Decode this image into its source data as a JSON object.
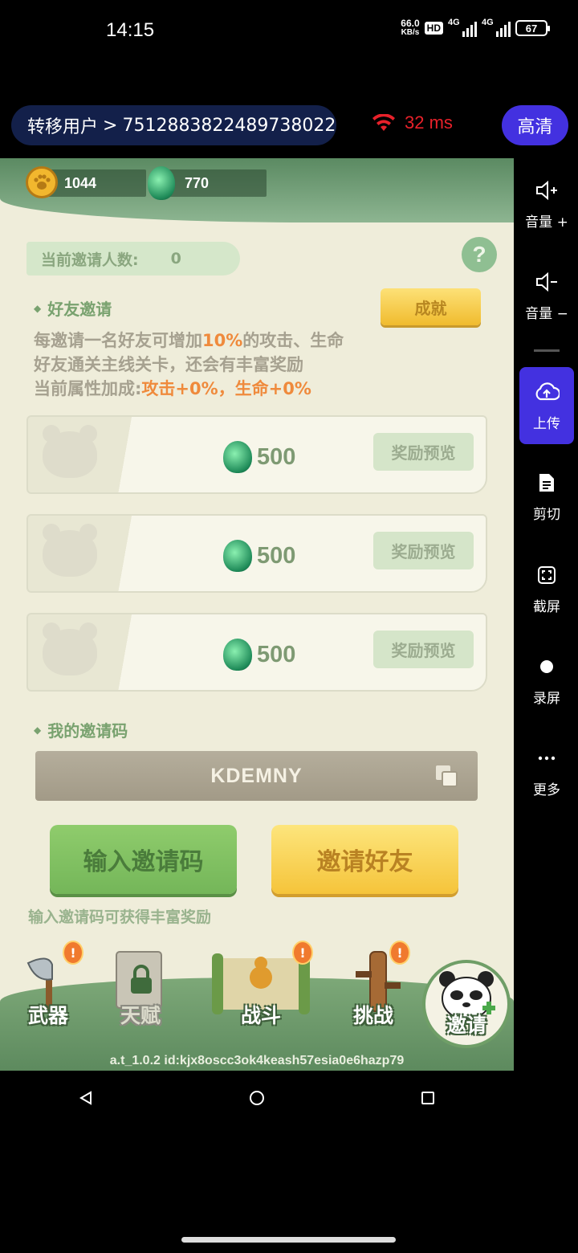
{
  "status_bar": {
    "time": "14:15",
    "net_speed_value": "66.0",
    "net_speed_unit": "KB/s",
    "hd_badge": "HD",
    "signal1_label": "4G",
    "signal2_label": "4G",
    "battery": "67"
  },
  "top_bar": {
    "transfer_label": "转移用户",
    "user_id": "7512883822489738022",
    "latency": "32 ms",
    "quality_button": "高清"
  },
  "side_toolbar": {
    "items": [
      {
        "label": "音量 +",
        "icon": "volume-up-icon"
      },
      {
        "label": "音量 −",
        "icon": "volume-down-icon"
      },
      {
        "label": "上传",
        "icon": "cloud-upload-icon"
      },
      {
        "label": "剪切",
        "icon": "document-icon"
      },
      {
        "label": "截屏",
        "icon": "screenshot-icon"
      },
      {
        "label": "录屏",
        "icon": "record-icon"
      },
      {
        "label": "更多",
        "icon": "more-icon"
      }
    ]
  },
  "game": {
    "resources": {
      "coins": "1044",
      "gems": "770"
    },
    "invite_count_label": "当前邀请人数:",
    "invite_count_value": "0",
    "help_icon": "?",
    "friend_invite_title": "好友邀请",
    "achievement_button": "成就",
    "desc_line1_a": "每邀请一名好友可增加",
    "desc_line1_hl": "10%",
    "desc_line1_b": "的攻击、生命",
    "desc_line2": "好友通关主线关卡，还会有丰富奖励",
    "desc_line3_a": "当前属性加成:",
    "desc_line3_hl": "攻击+0%，生命+0%",
    "reward_cards": [
      {
        "amount": "500",
        "preview": "奖励预览"
      },
      {
        "amount": "500",
        "preview": "奖励预览"
      },
      {
        "amount": "500",
        "preview": "奖励预览"
      }
    ],
    "my_code_title": "我的邀请码",
    "invite_code": "KDEMNY",
    "enter_code_button": "输入邀请码",
    "invite_friends_button": "邀请好友",
    "enter_code_hint": "输入邀请码可获得丰富奖励",
    "bottom_nav": [
      {
        "label": "武器",
        "alert": "!"
      },
      {
        "label": "天赋"
      },
      {
        "label": "战斗",
        "alert": "!"
      },
      {
        "label": "挑战",
        "alert": "!"
      },
      {
        "label": "邀请"
      }
    ],
    "build_id": "a.t_1.0.2 id:kjx8oscc3ok4keash57esia0e6hazp79"
  },
  "colors": {
    "accent": "#4331e0",
    "latency": "#e8212a",
    "highlight": "#ef8a3c"
  }
}
